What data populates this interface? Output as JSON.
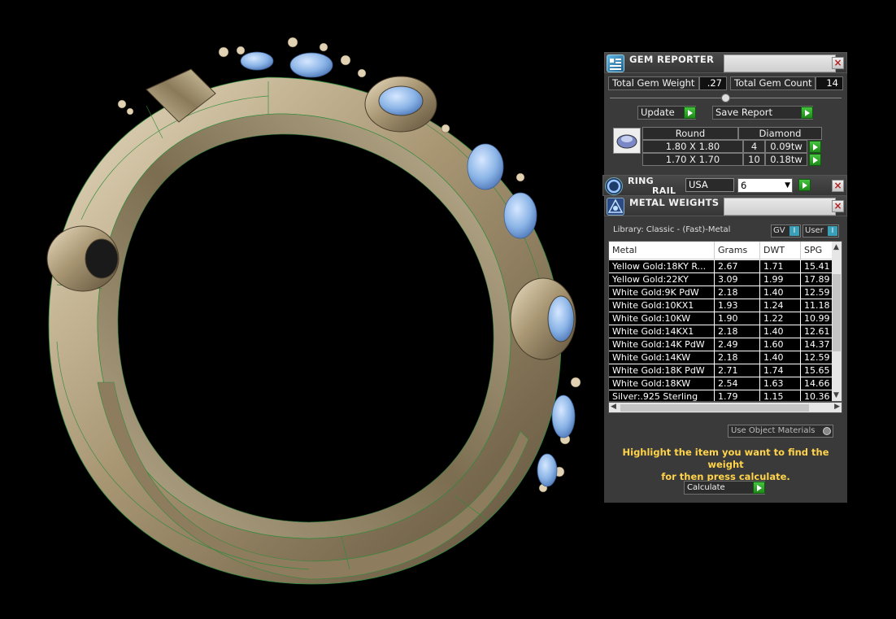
{
  "gem_reporter": {
    "title": "GEM REPORTER",
    "close": "×",
    "total_gem_weight_label": "Total Gem Weight",
    "total_gem_weight_value": ".27",
    "total_gem_count_label": "Total Gem Count",
    "total_gem_count_value": "14",
    "update_label": "Update",
    "save_report_label": "Save Report",
    "table": {
      "headers": [
        "Round",
        "Diamond"
      ],
      "rows": [
        {
          "size": "1.80 X 1.80",
          "count": "4",
          "weight": "0.09tw"
        },
        {
          "size": "1.70 X 1.70",
          "count": "10",
          "weight": "0.18tw"
        }
      ]
    }
  },
  "ring_rail": {
    "title_line1": "RING",
    "title_line2": "RAIL",
    "region_value": "USA",
    "size_value": "6",
    "close": "×"
  },
  "metal_weights": {
    "title": "METAL WEIGHTS",
    "close": "×",
    "library_label": "Library: Classic - (Fast)-Metal",
    "gv_label": "GV",
    "user_label": "User",
    "columns": [
      "Metal",
      "Grams",
      "DWT",
      "SPG"
    ],
    "rows": [
      {
        "metal": "Yellow Gold:18KY R...",
        "grams": "2.67",
        "dwt": "1.71",
        "spg": "15.41"
      },
      {
        "metal": "Yellow Gold:22KY",
        "grams": "3.09",
        "dwt": "1.99",
        "spg": "17.89"
      },
      {
        "metal": "White Gold:9K PdW",
        "grams": "2.18",
        "dwt": "1.40",
        "spg": "12.59"
      },
      {
        "metal": "White Gold:10KX1",
        "grams": "1.93",
        "dwt": "1.24",
        "spg": "11.18"
      },
      {
        "metal": "White Gold:10KW",
        "grams": "1.90",
        "dwt": "1.22",
        "spg": "10.99"
      },
      {
        "metal": "White Gold:14KX1",
        "grams": "2.18",
        "dwt": "1.40",
        "spg": "12.61"
      },
      {
        "metal": "White Gold:14K PdW",
        "grams": "2.49",
        "dwt": "1.60",
        "spg": "14.37"
      },
      {
        "metal": "White Gold:14KW",
        "grams": "2.18",
        "dwt": "1.40",
        "spg": "12.59"
      },
      {
        "metal": "White Gold:18K PdW",
        "grams": "2.71",
        "dwt": "1.74",
        "spg": "15.65"
      },
      {
        "metal": "White Gold:18KW",
        "grams": "2.54",
        "dwt": "1.63",
        "spg": "14.66"
      },
      {
        "metal": "Silver:.925 Sterling",
        "grams": "1.79",
        "dwt": "1.15",
        "spg": "10.36"
      }
    ],
    "use_object_materials_label": "Use Object Materials",
    "hint_line1": "Highlight the item you want to find the weight",
    "hint_line2": "for then press calculate.",
    "calculate_label": "Calculate"
  },
  "colors": {
    "panel_bg": "#3a3a3a",
    "hint_text": "#ffd34a",
    "go_button": "#2fa82a",
    "metal": "#c7b99a",
    "gem": "#8ab4e6",
    "wireframe": "#2e8a3a"
  }
}
